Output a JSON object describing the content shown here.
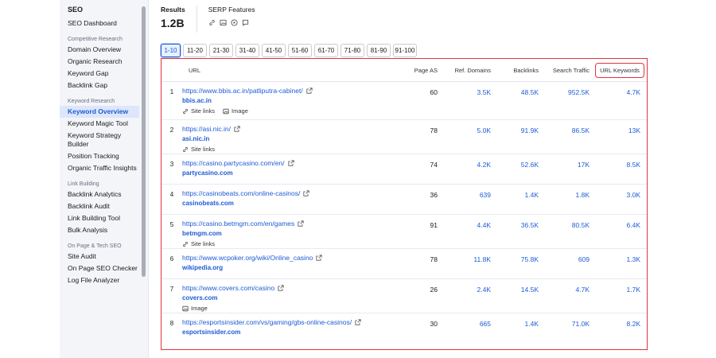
{
  "sidebar": {
    "title": "SEO",
    "top_item": "SEO Dashboard",
    "sections": [
      {
        "label": "Competitive Research",
        "items": [
          "Domain Overview",
          "Organic Research",
          "Keyword Gap",
          "Backlink Gap"
        ]
      },
      {
        "label": "Keyword Research",
        "items": [
          "Keyword Overview",
          "Keyword Magic Tool",
          "Keyword Strategy Builder",
          "Position Tracking",
          "Organic Traffic Insights"
        ]
      },
      {
        "label": "Link Building",
        "items": [
          "Backlink Analytics",
          "Backlink Audit",
          "Link Building Tool",
          "Bulk Analysis"
        ]
      },
      {
        "label": "On Page & Tech SEO",
        "items": [
          "Site Audit",
          "On Page SEO Checker",
          "Log File Analyzer"
        ]
      }
    ],
    "active_item": "Keyword Overview"
  },
  "header": {
    "results_label": "Results",
    "results_value": "1.2B",
    "serp_label": "SERP Features",
    "serp_icons": [
      "link-icon",
      "image-icon",
      "video-icon",
      "review-icon"
    ]
  },
  "pager": {
    "pages": [
      "1-10",
      "11-20",
      "21-30",
      "31-40",
      "41-50",
      "51-60",
      "61-70",
      "71-80",
      "81-90",
      "91-100"
    ],
    "active": "1-10"
  },
  "table": {
    "columns": {
      "url": "URL",
      "page_as": "Page AS",
      "ref_domains": "Ref. Domains",
      "backlinks": "Backlinks",
      "search_traffic": "Search Traffic",
      "url_keywords": "URL Keywords"
    },
    "rows": [
      {
        "num": "1",
        "url": "https://www.bbis.ac.in/patliputra-cabinet/",
        "domain": "bbis.ac.in",
        "features": [
          "Site links",
          "Image"
        ],
        "page_as": "60",
        "ref_domains": "3.5K",
        "backlinks": "48.5K",
        "search_traffic": "952.5K",
        "url_keywords": "4.7K"
      },
      {
        "num": "2",
        "url": "https://asi.nic.in/",
        "domain": "asi.nic.in",
        "features": [
          "Site links"
        ],
        "page_as": "78",
        "ref_domains": "5.0K",
        "backlinks": "91.9K",
        "search_traffic": "86.5K",
        "url_keywords": "13K"
      },
      {
        "num": "3",
        "url": "https://casino.partycasino.com/en/",
        "domain": "partycasino.com",
        "features": [],
        "page_as": "74",
        "ref_domains": "4.2K",
        "backlinks": "52.6K",
        "search_traffic": "17K",
        "url_keywords": "8.5K"
      },
      {
        "num": "4",
        "url": "https://casinobeats.com/online-casinos/",
        "domain": "casinobeats.com",
        "features": [],
        "page_as": "36",
        "ref_domains": "639",
        "backlinks": "1.4K",
        "search_traffic": "1.8K",
        "url_keywords": "3.0K"
      },
      {
        "num": "5",
        "url": "https://casino.betmgm.com/en/games",
        "domain": "betmgm.com",
        "features": [
          "Site links"
        ],
        "page_as": "91",
        "ref_domains": "4.4K",
        "backlinks": "36.5K",
        "search_traffic": "80.5K",
        "url_keywords": "6.4K"
      },
      {
        "num": "6",
        "url": "https://www.wcpoker.org/wiki/Online_casino",
        "domain": "wikipedia.org",
        "features": [],
        "page_as": "78",
        "ref_domains": "11.8K",
        "backlinks": "75.8K",
        "search_traffic": "609",
        "url_keywords": "1.3K"
      },
      {
        "num": "7",
        "url": "https://www.covers.com/casino",
        "domain": "covers.com",
        "features": [
          "Image"
        ],
        "page_as": "26",
        "ref_domains": "2.4K",
        "backlinks": "14.5K",
        "search_traffic": "4.7K",
        "url_keywords": "1.7K"
      },
      {
        "num": "8",
        "url": "https://esportsinsider.com/vs/gaming/gbs-online-casinos/",
        "domain": "esportsinsider.com",
        "features": [],
        "page_as": "30",
        "ref_domains": "665",
        "backlinks": "1.4K",
        "search_traffic": "71.0K",
        "url_keywords": "8.2K"
      }
    ]
  },
  "colors": {
    "accent": "#1e5bd6",
    "highlight_border": "#e0343d",
    "sidebar_bg": "#f4f5f9",
    "active_bg": "#dde6fb"
  }
}
